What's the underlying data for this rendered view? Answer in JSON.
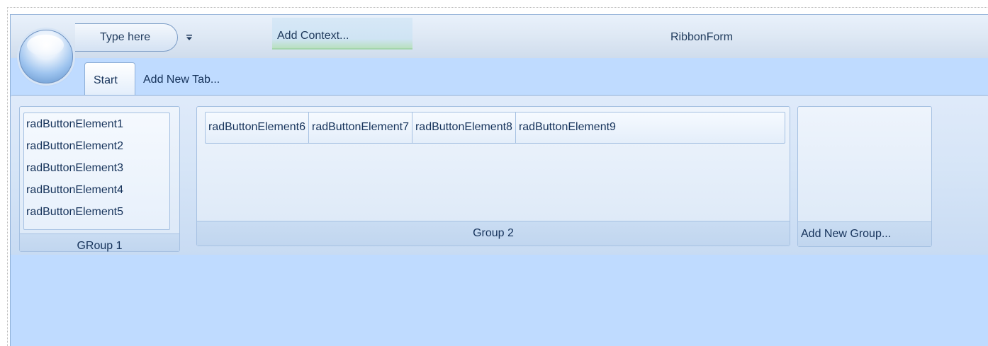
{
  "window": {
    "title": "RibbonForm"
  },
  "quick_access": {
    "placeholder_text": "Type here",
    "customize_icon": "dropdown-arrow-icon"
  },
  "context": {
    "add_label": "Add Context..."
  },
  "tabs": [
    {
      "label": "Start",
      "selected": true
    },
    {
      "label": "Add New Tab...",
      "selected": false
    }
  ],
  "groups": {
    "group1": {
      "caption": "GRoup 1",
      "buttons": [
        "radButtonElement1",
        "radButtonElement2",
        "radButtonElement3",
        "radButtonElement4",
        "radButtonElement5"
      ]
    },
    "group2": {
      "caption": "Group 2",
      "buttons": [
        "radButtonElement6",
        "radButtonElement7",
        "radButtonElement8",
        "radButtonElement9"
      ]
    },
    "add_new": {
      "caption": "Add New Group..."
    }
  },
  "colors": {
    "ribbon_background": "#bfdbff",
    "text": "#15325a"
  }
}
